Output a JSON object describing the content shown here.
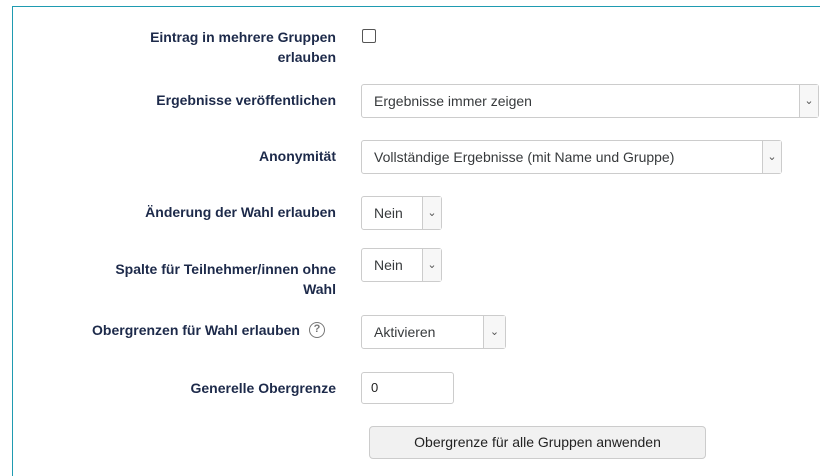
{
  "form": {
    "multi_group": {
      "label_line1": "Eintrag in mehrere Gruppen",
      "label_line2": "erlauben",
      "checked": false
    },
    "publish_results": {
      "label": "Ergebnisse veröffentlichen",
      "value": "Ergebnisse immer zeigen"
    },
    "anonymity": {
      "label": "Anonymität",
      "value": "Vollständige Ergebnisse (mit Name und Gruppe)"
    },
    "allow_change": {
      "label": "Änderung der Wahl erlauben",
      "value": "Nein"
    },
    "no_choice_column": {
      "label_line1": "Spalte für Teilnehmer/innen ohne",
      "label_line2": "Wahl",
      "value": "Nein"
    },
    "limits": {
      "label": "Obergrenzen für Wahl erlauben",
      "help_icon": "help-icon",
      "value": "Aktivieren"
    },
    "general_limit": {
      "label": "Generelle Obergrenze",
      "value": "0"
    },
    "apply_button": {
      "label": "Obergrenze für alle Gruppen anwenden"
    }
  },
  "colors": {
    "accent_border": "#1f9bb1",
    "label_text": "#1d2a4a"
  }
}
